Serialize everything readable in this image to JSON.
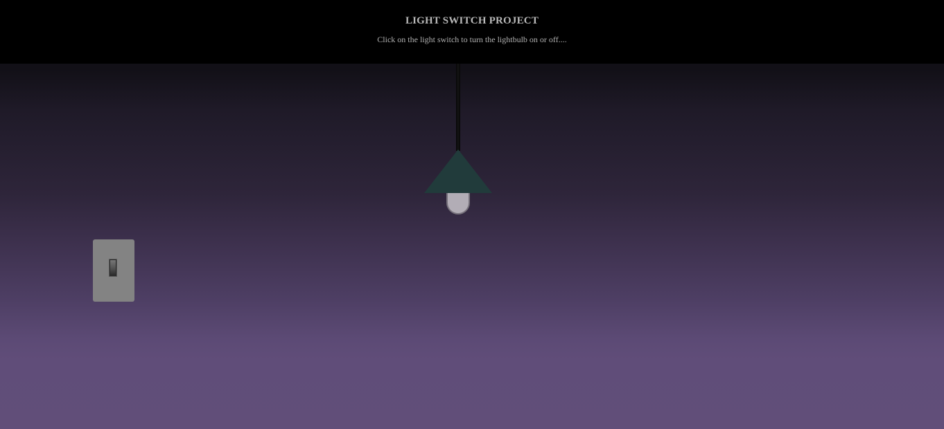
{
  "header": {
    "title": "LIGHT SWITCH PROJECT",
    "subtitle": "Click on the light switch to turn the lightbulb on or off...."
  },
  "lamp": {
    "state": "off",
    "shade_color": "#213b3b",
    "bulb_color": "#b2adb6"
  },
  "light_switch": {
    "state": "off",
    "plate_color": "#838383"
  },
  "colors": {
    "header_background": "#000000",
    "wall_top": "#0f0d12",
    "wall_bottom": "#614e79"
  }
}
